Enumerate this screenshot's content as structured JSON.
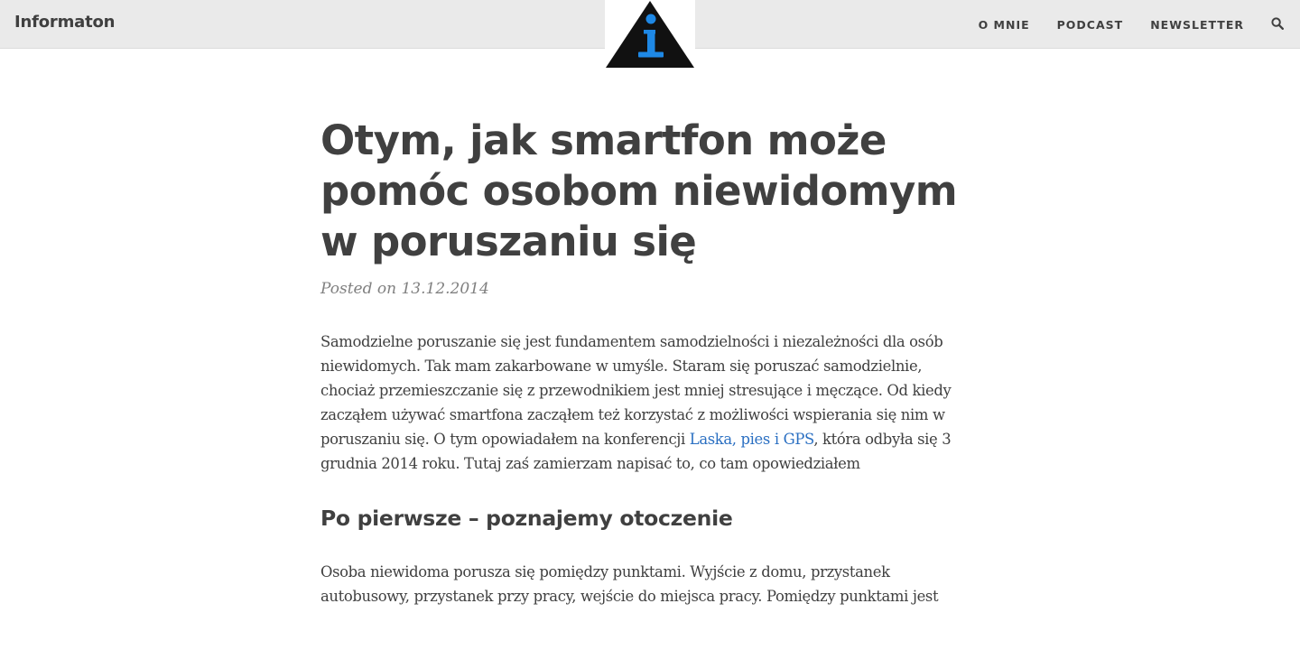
{
  "nav": {
    "brand": "Informaton",
    "links": [
      {
        "label": "O MNIE"
      },
      {
        "label": "PODCAST"
      },
      {
        "label": "NEWSLETTER"
      }
    ],
    "search_icon": "search-icon"
  },
  "logo": {
    "icon": "info-triangle-logo",
    "colors": {
      "triangle": "#111111",
      "letter": "#1e88e5"
    }
  },
  "post": {
    "title": "Otym, jak smartfon może pomóc osobom niewidomym w poruszaniu się",
    "meta": "Posted on 13.12.2014",
    "paragraph1_before": "Samodzielne poruszanie się jest fundamentem samodzielności i niezależności dla osób niewidomych. Tak mam zakarbowane w umyśle. Staram się poruszać samodzielnie, chociaż przemieszczanie się z przewodnikiem jest mniej stresujące i męczące. Od kiedy zacząłem używać smartfona zacząłem też korzystać z możliwości wspierania się nim w poruszaniu się. O tym opowiadałem na konferencji ",
    "paragraph1_link": "Laska, pies i GPS",
    "paragraph1_after": ", która odbyła się 3 grudnia 2014 roku. Tutaj zaś zamierzam napisać to, co tam opowiedziałem",
    "section_heading": "Po pierwsze – poznajemy otoczenie",
    "paragraph2": "Osoba niewidoma porusza się pomiędzy punktami. Wyjście z domu, przystanek autobusowy, przystanek przy pracy, wejście do miejsca pracy. Pomiędzy punktami jest"
  },
  "colors": {
    "navbar_bg": "#eaeaea",
    "text": "#404040",
    "meta": "#808080",
    "link": "#2a6fc2"
  }
}
